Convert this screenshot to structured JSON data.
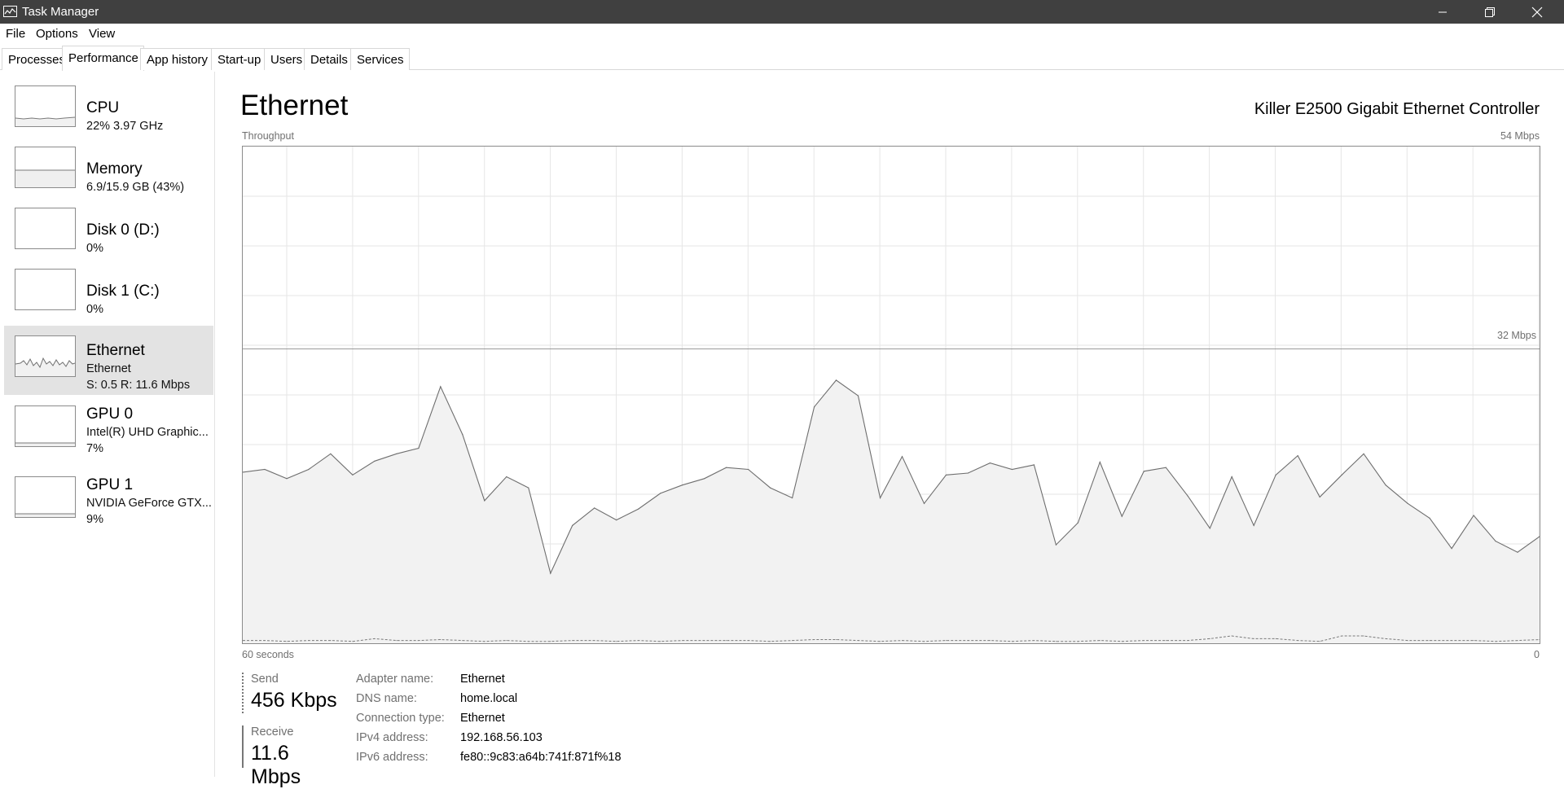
{
  "window": {
    "title": "Task Manager",
    "icon": "task-manager-icon"
  },
  "menu": {
    "file": "File",
    "options": "Options",
    "view": "View"
  },
  "tabs": [
    "Processes",
    "Performance",
    "App history",
    "Start-up",
    "Users",
    "Details",
    "Services"
  ],
  "active_tab": "Performance",
  "sidebar": {
    "items": [
      {
        "name": "CPU",
        "line1": "22%  3.97 GHz",
        "line2": ""
      },
      {
        "name": "Memory",
        "line1": "6.9/15.9 GB (43%)",
        "line2": ""
      },
      {
        "name": "Disk 0 (D:)",
        "line1": "0%",
        "line2": ""
      },
      {
        "name": "Disk 1 (C:)",
        "line1": "0%",
        "line2": ""
      },
      {
        "name": "Ethernet",
        "line1": "Ethernet",
        "line2": "S: 0.5  R: 11.6 Mbps"
      },
      {
        "name": "GPU 0",
        "line1": "Intel(R) UHD Graphic...",
        "line2": "7%"
      },
      {
        "name": "GPU 1",
        "line1": "NVIDIA GeForce GTX...",
        "line2": "9%"
      }
    ],
    "selected": "Ethernet"
  },
  "main": {
    "title": "Ethernet",
    "adapter_model": "Killer E2500 Gigabit Ethernet Controller",
    "throughput_label": "Throughput",
    "max_label": "54 Mbps",
    "mid_label": "32 Mbps",
    "time_label": "60 seconds",
    "zero_label": "0"
  },
  "stats": {
    "send_label": "Send",
    "send_value": "456 Kbps",
    "receive_label": "Receive",
    "receive_value": "11.6 Mbps"
  },
  "properties": [
    {
      "key": "Adapter name:",
      "value": "Ethernet"
    },
    {
      "key": "DNS name:",
      "value": "home.local"
    },
    {
      "key": "Connection type:",
      "value": "Ethernet"
    },
    {
      "key": "IPv4 address:",
      "value": "192.168.56.103"
    },
    {
      "key": "IPv6 address:",
      "value": "fe80::9c83:a64b:741f:871f%18"
    }
  ],
  "chart_data": {
    "type": "area",
    "ylim": [
      0,
      54
    ],
    "y_ticks_labeled": [
      54,
      32
    ],
    "series": [
      {
        "name": "Receive",
        "values": [
          18.6,
          18.9,
          17.9,
          18.9,
          20.6,
          18.3,
          19.8,
          20.6,
          21.2,
          27.9,
          22.7,
          15.5,
          18.1,
          16.9,
          7.6,
          12.8,
          14.7,
          13.4,
          14.6,
          16.3,
          17.2,
          17.9,
          19.1,
          18.9,
          16.9,
          15.8,
          25.7,
          28.6,
          26.9,
          15.8,
          20.3,
          15.2,
          18.3,
          18.5,
          19.6,
          18.9,
          19.4,
          10.7,
          13.1,
          19.7,
          13.8,
          18.7,
          19.1,
          16.0,
          12.5,
          18.1,
          12.8,
          18.3,
          20.4,
          15.9,
          18.3,
          20.6,
          17.2,
          15.2,
          13.6,
          10.3,
          13.9,
          11.1,
          9.9,
          11.6
        ]
      },
      {
        "name": "Send",
        "values": [
          0.3,
          0.3,
          0.2,
          0.3,
          0.3,
          0.2,
          0.5,
          0.3,
          0.3,
          0.4,
          0.3,
          0.2,
          0.3,
          0.2,
          0.2,
          0.3,
          0.3,
          0.2,
          0.3,
          0.2,
          0.3,
          0.3,
          0.3,
          0.3,
          0.2,
          0.3,
          0.4,
          0.4,
          0.3,
          0.2,
          0.3,
          0.2,
          0.3,
          0.3,
          0.3,
          0.2,
          0.3,
          0.2,
          0.2,
          0.3,
          0.2,
          0.3,
          0.3,
          0.3,
          0.5,
          0.8,
          0.5,
          0.5,
          0.3,
          0.2,
          0.8,
          0.8,
          0.5,
          0.3,
          0.3,
          0.3,
          0.3,
          0.2,
          0.3,
          0.4
        ]
      }
    ],
    "grid": true
  }
}
